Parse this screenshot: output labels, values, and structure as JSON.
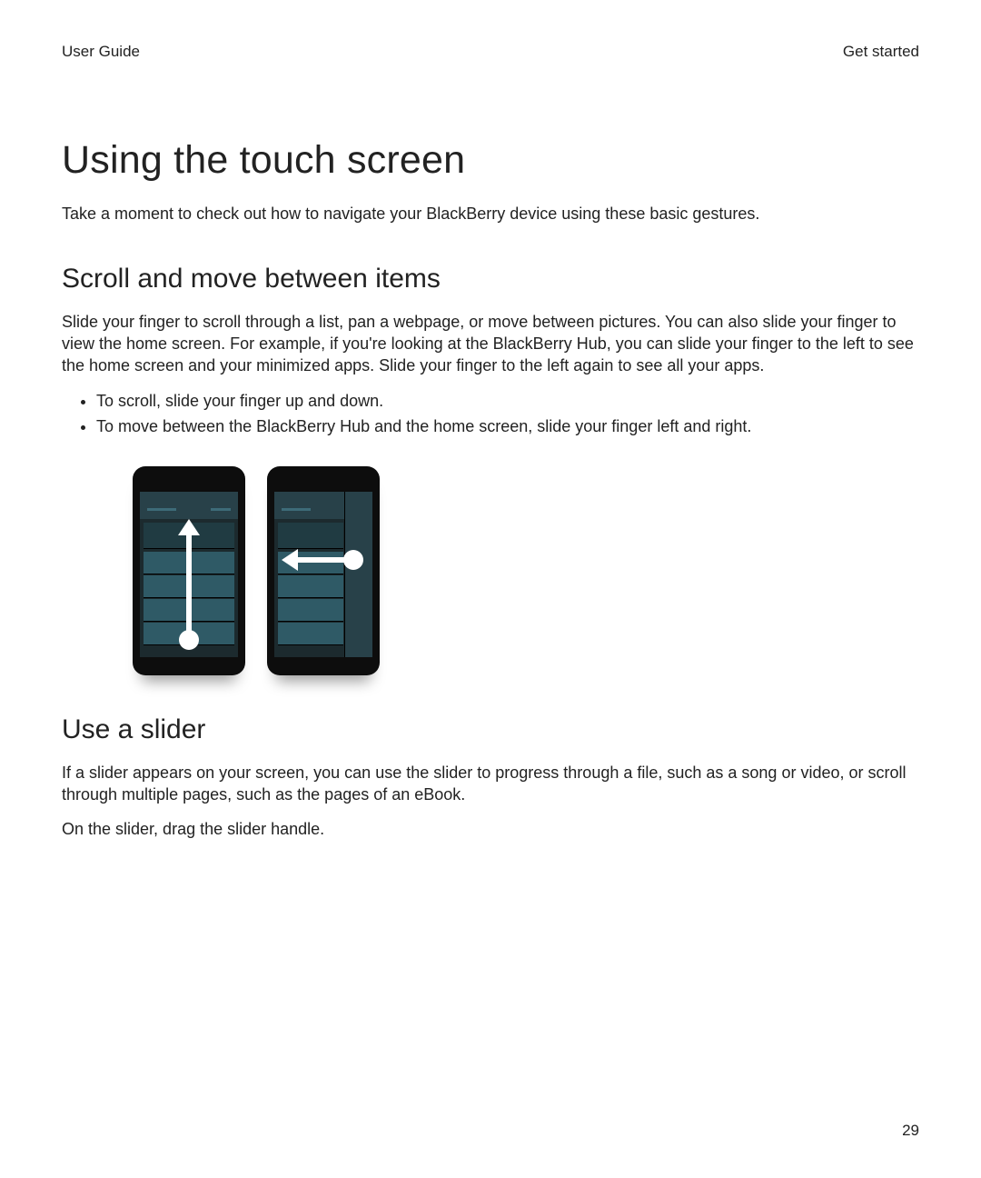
{
  "header": {
    "left": "User Guide",
    "right": "Get started"
  },
  "title": "Using the touch screen",
  "intro": "Take a moment to check out how to navigate your BlackBerry device using these basic gestures.",
  "section1": {
    "heading": "Scroll and move between items",
    "body": "Slide your finger to scroll through a list, pan a webpage, or move between pictures. You can also slide your finger to view the home screen. For example, if you're looking at the BlackBerry Hub, you can slide your finger to the left to see the home screen and your minimized apps. Slide your finger to the left again to see all your apps.",
    "bullets": [
      "To scroll, slide your finger up and down.",
      "To move between the BlackBerry Hub and the home screen, slide your finger left and right."
    ]
  },
  "section2": {
    "heading": "Use a slider",
    "body": "If a slider appears on your screen, you can use the slider to progress through a file, such as a song or video, or scroll through multiple pages, such as the pages of an eBook.",
    "instruction": "On the slider, drag the slider handle."
  },
  "page_number": "29"
}
